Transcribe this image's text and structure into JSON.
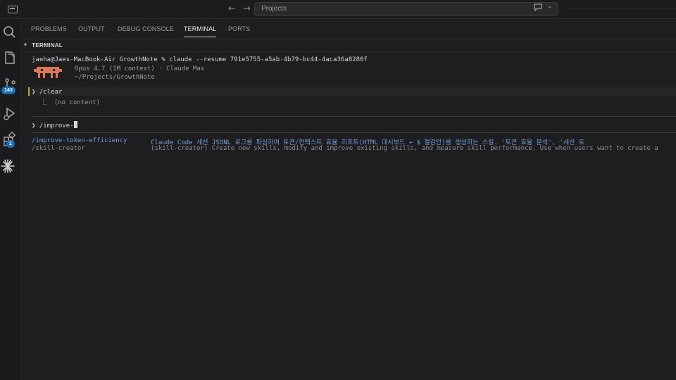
{
  "window": {
    "search_text": "Projects"
  },
  "activity_bar": {
    "scm_badge": "143",
    "extensions_badge": "1"
  },
  "panel": {
    "tabs": [
      {
        "label": "PROBLEMS"
      },
      {
        "label": "OUTPUT"
      },
      {
        "label": "DEBUG CONSOLE"
      },
      {
        "label": "TERMINAL",
        "active": true
      },
      {
        "label": "PORTS"
      }
    ],
    "section_title": "TERMINAL"
  },
  "terminal": {
    "command_line": "jaeha@Jaes-MacBook-Air GrowthNote % claude --resume 791e5755-a5ab-4b79-bc44-4aca36a8280f",
    "model_info": "Opus 4.7 (1M context) · Claude Max",
    "cwd": "~/Projects/GrowthNote",
    "prompt_symbol": "❯",
    "clear_cmd": "/clear",
    "clear_output": "⎿  (no content)",
    "input_text": "/improve-",
    "suggestions": [
      {
        "name": "/improve-token-efficiency",
        "description": "Claude Code 세션 JSONL 로그를 파싱하여 토큰/컨텍스트 효율 리포트(HTML 대시보드 + $ 절감안)를 생성하는 스킬. '토큰 효율 분석', '세션 토"
      },
      {
        "name": "/skill-creator",
        "description": "(skill-creator) Create new skills, modify and improve existing skills, and measure skill performance. Use when users want to create a"
      }
    ]
  },
  "colors": {
    "accent_blue": "#6f9ed6",
    "logo_orange": "#d9775b",
    "badge_blue": "#1b6fb3"
  }
}
